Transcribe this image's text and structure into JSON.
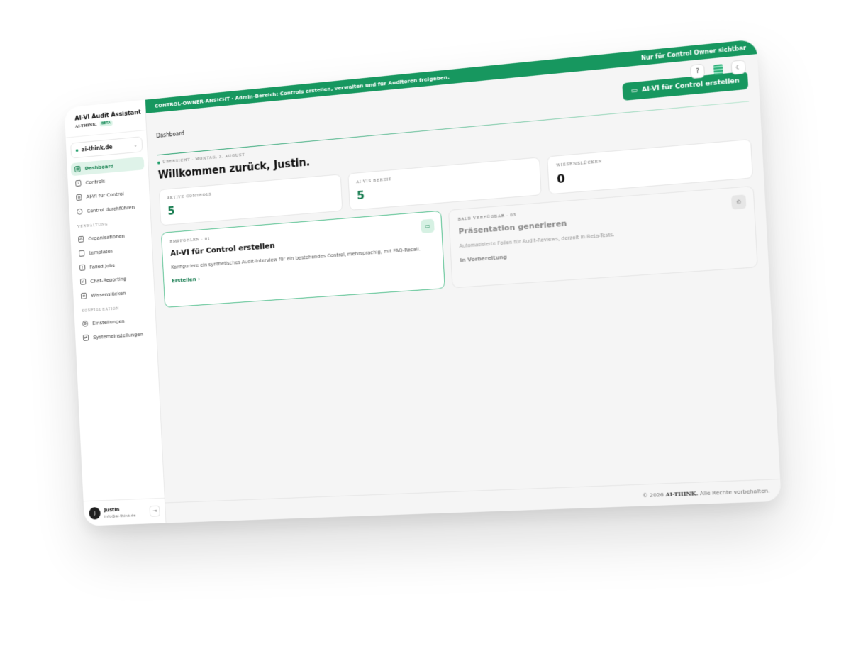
{
  "brand": {
    "title": "AI-VI Audit Assistant",
    "company": "AI-THINK.",
    "badge": "BETA"
  },
  "org": {
    "name": "ai-think.de",
    "chevron": "chevron-down-icon"
  },
  "nav": {
    "main": [
      {
        "label": "Dashboard",
        "icon": "grid-icon",
        "active": true
      },
      {
        "label": "Controls",
        "icon": "play-icon"
      },
      {
        "label": "AI-VI für Control",
        "icon": "chat-icon"
      },
      {
        "label": "Control durchführen",
        "icon": "eye-icon"
      }
    ],
    "section_admin": "VERWALTUNG",
    "admin": [
      {
        "label": "Organisationen",
        "icon": "org-icon"
      },
      {
        "label": "templates",
        "icon": "bookmark-icon"
      },
      {
        "label": "Failed Jobs",
        "icon": "warning-icon"
      },
      {
        "label": "Chat-Reporting",
        "icon": "chart-icon"
      },
      {
        "label": "Wissenslücken",
        "icon": "list-icon"
      }
    ],
    "section_config": "KONFIGURATION",
    "config": [
      {
        "label": "Einstellungen",
        "icon": "gear-icon"
      },
      {
        "label": "Systemeinstellungen",
        "icon": "sliders-icon"
      }
    ]
  },
  "user": {
    "initial": "J",
    "name": "Justin",
    "email": "info@ai-think.de"
  },
  "banner": {
    "left": "CONTROL-OWNER-ANSICHT · Admin-Bereich: Controls erstellen, verwalten und für Auditoren freigeben.",
    "right": "Nur für Control Owner sichtbar"
  },
  "header": {
    "breadcrumb": "Dashboard",
    "cta": "AI-VI für Control erstellen"
  },
  "overview": {
    "eyebrow": "ÜBERSICHT · MONTAG, 3. AUGUST",
    "welcome": "Willkommen zurück, Justin."
  },
  "stats": [
    {
      "label": "AKTIVE CONTROLS",
      "value": "5"
    },
    {
      "label": "AI-VIS BEREIT",
      "value": "5"
    },
    {
      "label": "WISSENSLÜCKEN",
      "value": "0"
    }
  ],
  "cards": {
    "recommended": {
      "kicker": "EMPFOHLEN · 01",
      "title": "AI-VI für Control erstellen",
      "desc": "Konfiguriere ein synthetisches Audit-Interview für ein bestehendes Control, mehrsprachig, mit FAQ-Recall.",
      "link": "Erstellen",
      "icon": "chat-icon"
    },
    "soon": {
      "kicker": "BALD VERFÜGBAR · 03",
      "title": "Präsentation generieren",
      "desc": "Automatisierte Folien für Audit-Reviews, derzeit in Beta-Tests.",
      "status": "In Vorbereitung",
      "icon": "gear-icon"
    }
  },
  "footer": {
    "prefix": "© 2026",
    "brand": "AI-THINK.",
    "suffix": "Alle Rechte vorbehalten."
  },
  "colors": {
    "accent": "#17975f",
    "accent_light": "#dff3e9"
  }
}
